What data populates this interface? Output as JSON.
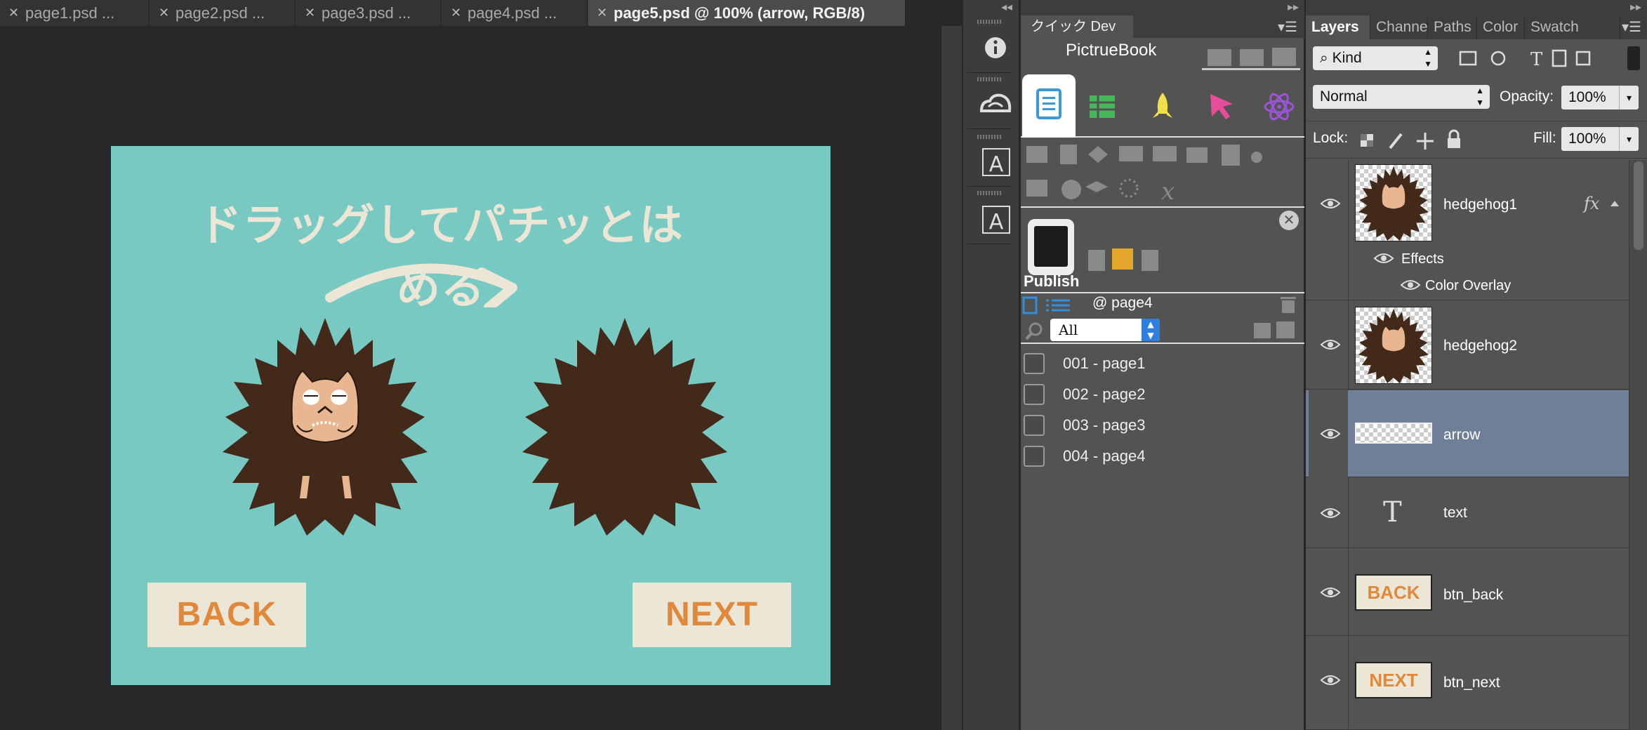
{
  "tabs": [
    {
      "label": "page1.psd ...",
      "active": false
    },
    {
      "label": "page2.psd ...",
      "active": false
    },
    {
      "label": "page3.psd ...",
      "active": false
    },
    {
      "label": "page4.psd ...",
      "active": false
    },
    {
      "label": "page5.psd @ 100% (arrow, RGB/8)",
      "active": true
    }
  ],
  "document": {
    "title": "ドラッグしてパチッとはめる",
    "back_label": "BACK",
    "next_label": "NEXT",
    "colors": {
      "background": "#77c9c2",
      "cream": "#ece6d6",
      "accent": "#e0893c",
      "hedgehog": "#42291a"
    }
  },
  "toolstrip": {
    "icons": [
      "info-icon",
      "creative-cloud-icon",
      "character-icon",
      "paragraph-icon"
    ]
  },
  "quickdev": {
    "tab_label": "クイック Dev",
    "subtitle": "PictrueBook",
    "publish_label": "Publish",
    "page_header": "@ page4",
    "filter_value": "All",
    "pages": [
      "001 - page1",
      "002 - page2",
      "003 - page3",
      "004 - page4"
    ]
  },
  "layers": {
    "tabs": [
      "Layers",
      "Channe",
      "Paths",
      "Color",
      "Swatch"
    ],
    "kind_label": "Kind",
    "blend_mode": "Normal",
    "opacity_label": "Opacity:",
    "opacity_value": "100%",
    "lock_label": "Lock:",
    "fill_label": "Fill:",
    "fill_value": "100%",
    "fx_label": "fx",
    "effects_label": "Effects",
    "color_overlay_label": "Color Overlay",
    "items": [
      {
        "name": "hedgehog1"
      },
      {
        "name": "hedgehog2"
      },
      {
        "name": "arrow"
      },
      {
        "name": "text"
      },
      {
        "name": "btn_back",
        "thumb_text": "BACK"
      },
      {
        "name": "btn_next",
        "thumb_text": "NEXT"
      }
    ],
    "selected_color": "#6f7f98"
  }
}
